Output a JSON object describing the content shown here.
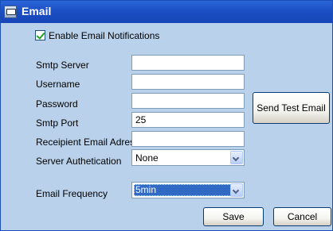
{
  "window": {
    "title": "Email"
  },
  "enable_notifications": {
    "label": "Enable Email Notifications",
    "checked": true
  },
  "fields": {
    "smtp_server": {
      "label": "Smtp Server",
      "value": ""
    },
    "username": {
      "label": "Username",
      "value": ""
    },
    "password": {
      "label": "Password",
      "value": ""
    },
    "smtp_port": {
      "label": "Smtp Port",
      "value": "25"
    },
    "recipient": {
      "label": "Receipient Email Adress",
      "value": ""
    }
  },
  "server_auth": {
    "label": "Server Authetication",
    "selected": "None"
  },
  "email_frequency": {
    "label": "Email Frequency",
    "selected": "5min"
  },
  "buttons": {
    "send_test": "Send Test Email",
    "save": "Save",
    "cancel": "Cancel"
  },
  "colors": {
    "window_bg": "#b9d1ea",
    "titlebar": "#1c4fc4",
    "selection": "#316ac5"
  }
}
